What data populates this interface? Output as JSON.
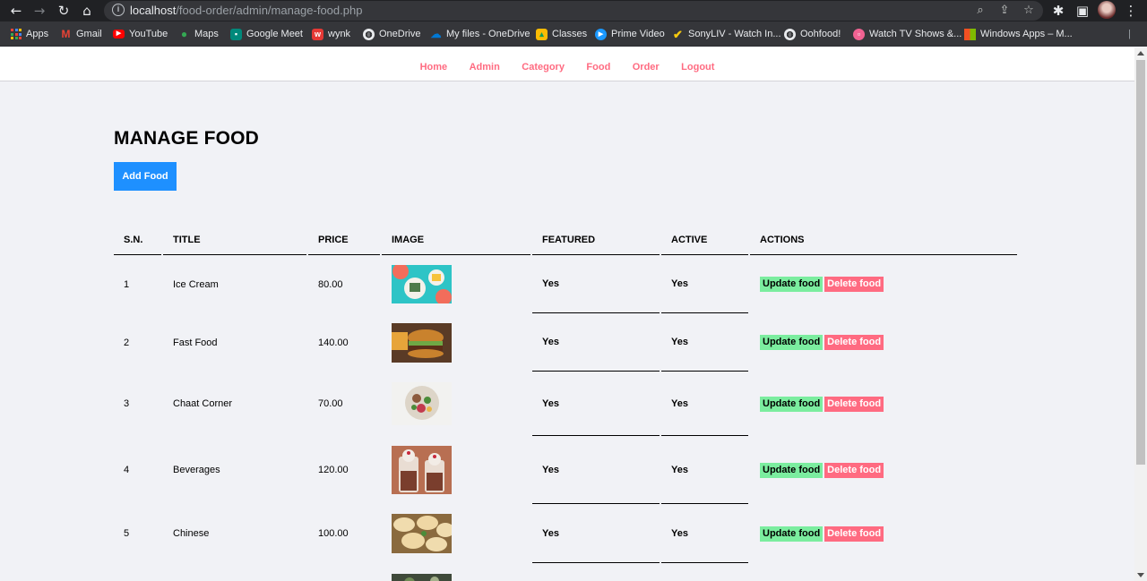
{
  "browser": {
    "url_host": "localhost",
    "url_path": "/food-order/admin/manage-food.php",
    "bookmarks": [
      {
        "label": "Apps",
        "icon": "apps-grid-icon",
        "color": "#4285f4"
      },
      {
        "label": "Gmail",
        "icon": "gmail-icon",
        "color": "#ea4335"
      },
      {
        "label": "YouTube",
        "icon": "youtube-icon",
        "color": "#ff0000"
      },
      {
        "label": "Maps",
        "icon": "maps-pin-icon",
        "color": "#34a853"
      },
      {
        "label": "Google Meet",
        "icon": "meet-icon",
        "color": "#00897b"
      },
      {
        "label": "wynk",
        "icon": "wynk-icon",
        "color": "#e53935"
      },
      {
        "label": "OneDrive",
        "icon": "globe-icon",
        "color": "#e8eaed"
      },
      {
        "label": "My files - OneDrive",
        "icon": "onedrive-cloud-icon",
        "color": "#0078d4"
      },
      {
        "label": "Classes",
        "icon": "classroom-icon",
        "color": "#fbbc04"
      },
      {
        "label": "Prime Video",
        "icon": "prime-video-icon",
        "color": "#1a98ff"
      },
      {
        "label": "SonyLIV - Watch In...",
        "icon": "sonyliv-check-icon",
        "color": "#f6c90e"
      },
      {
        "label": "Oohfood!",
        "icon": "globe-icon",
        "color": "#e8eaed"
      },
      {
        "label": "Watch TV Shows &...",
        "icon": "tv-icon",
        "color": "#f06292"
      },
      {
        "label": "Windows Apps – M...",
        "icon": "windows-icon",
        "color": "#f25022"
      }
    ]
  },
  "menu": {
    "items": [
      "Home",
      "Admin",
      "Category",
      "Food",
      "Order",
      "Logout"
    ],
    "color": "#ff6b81"
  },
  "main": {
    "title": "MANAGE FOOD",
    "add_button": "Add Food",
    "add_button_color": "#1e90ff"
  },
  "table": {
    "headers": [
      "S.N.",
      "TITLE",
      "PRICE",
      "IMAGE",
      "FEATURED",
      "ACTIVE",
      "ACTIONS"
    ],
    "update_label": "Update food",
    "delete_label": "Delete food",
    "rows": [
      {
        "sn": "1",
        "title": "Ice Cream",
        "price": "80.00",
        "featured": "Yes",
        "active": "Yes"
      },
      {
        "sn": "2",
        "title": "Fast Food",
        "price": "140.00",
        "featured": "Yes",
        "active": "Yes"
      },
      {
        "sn": "3",
        "title": "Chaat Corner",
        "price": "70.00",
        "featured": "Yes",
        "active": "Yes"
      },
      {
        "sn": "4",
        "title": "Beverages",
        "price": "120.00",
        "featured": "Yes",
        "active": "Yes"
      },
      {
        "sn": "5",
        "title": "Chinese",
        "price": "100.00",
        "featured": "Yes",
        "active": "Yes"
      }
    ]
  }
}
